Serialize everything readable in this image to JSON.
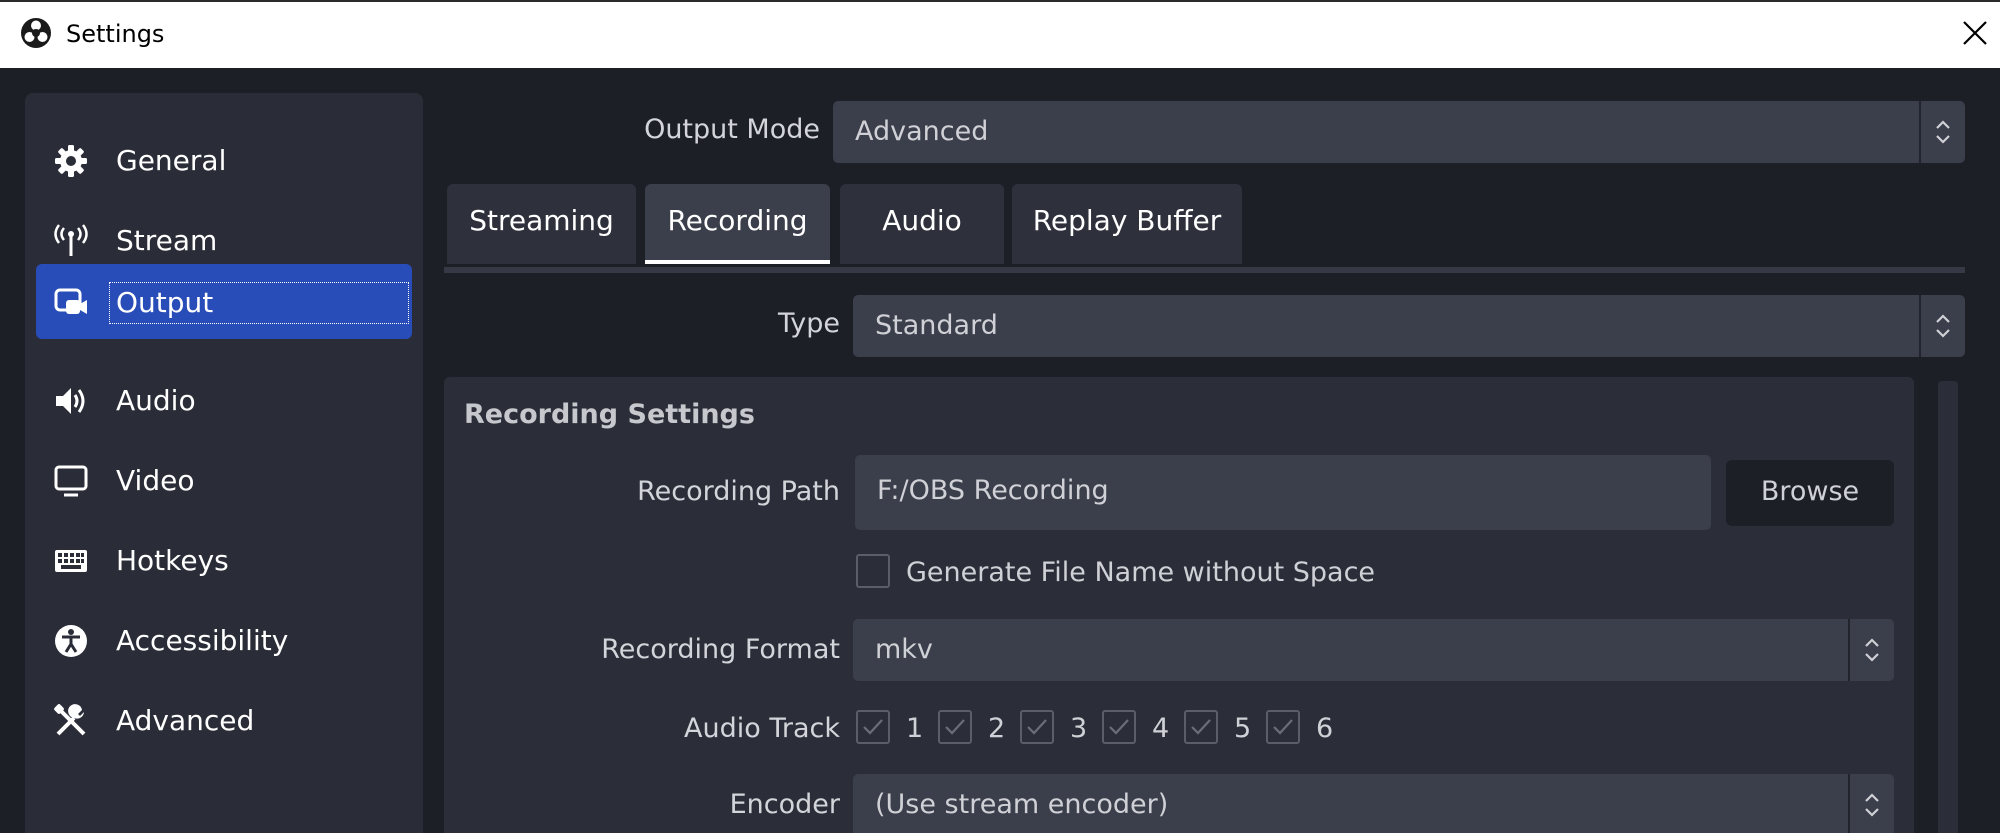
{
  "window": {
    "title": "Settings"
  },
  "sidebar": {
    "items": [
      {
        "label": "General",
        "icon": "gear-icon"
      },
      {
        "label": "Stream",
        "icon": "broadcast-icon"
      },
      {
        "label": "Output",
        "icon": "output-icon",
        "active": true
      },
      {
        "label": "Audio",
        "icon": "speaker-icon"
      },
      {
        "label": "Video",
        "icon": "monitor-icon"
      },
      {
        "label": "Hotkeys",
        "icon": "keyboard-icon"
      },
      {
        "label": "Accessibility",
        "icon": "accessibility-icon"
      },
      {
        "label": "Advanced",
        "icon": "tools-icon"
      }
    ]
  },
  "output_mode": {
    "label": "Output Mode",
    "value": "Advanced"
  },
  "tabs": [
    {
      "label": "Streaming"
    },
    {
      "label": "Recording",
      "active": true
    },
    {
      "label": "Audio"
    },
    {
      "label": "Replay Buffer"
    }
  ],
  "type_field": {
    "label": "Type",
    "value": "Standard"
  },
  "recording": {
    "section_title": "Recording Settings",
    "path_label": "Recording Path",
    "path_value": "F:/OBS Recording",
    "browse_label": "Browse",
    "nospace_label": "Generate File Name without Space",
    "format_label": "Recording Format",
    "format_value": "mkv",
    "audio_track_label": "Audio Track",
    "tracks": [
      "1",
      "2",
      "3",
      "4",
      "5",
      "6"
    ],
    "encoder_label": "Encoder",
    "encoder_value": "(Use stream encoder)"
  },
  "colors": {
    "accent": "#284cb8",
    "background": "#1d1f27",
    "panel": "#2b2e39",
    "field": "#3b3e4b"
  }
}
